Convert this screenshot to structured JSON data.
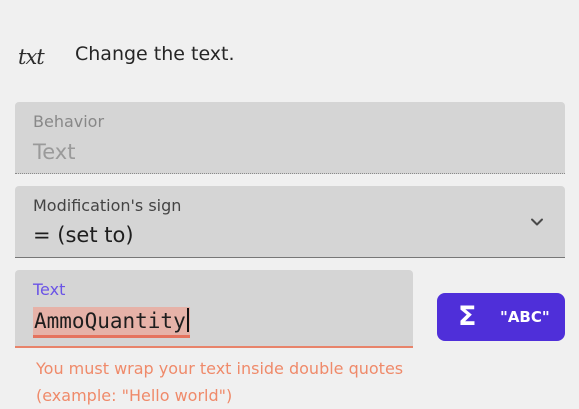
{
  "header": {
    "icon_glyph": "txt",
    "icon_name": "txt-icon",
    "description": "Change the text."
  },
  "behavior": {
    "label": "Behavior",
    "value": "Text",
    "disabled": true
  },
  "modification_sign": {
    "label": "Modification's sign",
    "value": "= (set to)",
    "icon_name": "chevron-down-icon"
  },
  "text_field": {
    "label": "Text",
    "value": "AmmoQuantity",
    "error": "You must wrap your text inside double quotes (example: \"Hello world\")"
  },
  "expression_button": {
    "icon_glyph": "Σ",
    "icon_name": "sigma-icon",
    "label": "\"ABC\""
  },
  "colors": {
    "accent": "#4f2fd9",
    "focus_label": "#6b54e6",
    "error": "#ef8a6a",
    "field_background": "#d5d5d5",
    "page_background": "#f0f0f0"
  }
}
